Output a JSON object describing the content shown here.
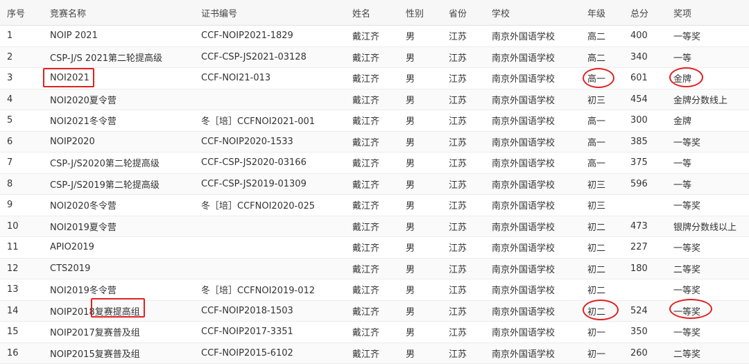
{
  "headers": [
    "序号",
    "竞赛名称",
    "证书编号",
    "姓名",
    "性别",
    "省份",
    "学校",
    "年级",
    "总分",
    "奖项"
  ],
  "rows": [
    [
      "1",
      "NOIP 2021",
      "CCF-NOIP2021-1829",
      "戴江齐",
      "男",
      "江苏",
      "南京外国语学校",
      "高二",
      "400",
      "一等奖"
    ],
    [
      "2",
      "CSP-J/S 2021第二轮提高级",
      "CCF-CSP-JS2021-03128",
      "戴江齐",
      "男",
      "江苏",
      "南京外国语学校",
      "高二",
      "340",
      "一等"
    ],
    [
      "3",
      "NOI2021",
      "CCF-NOI21-013",
      "戴江齐",
      "男",
      "江苏",
      "南京外国语学校",
      "高一",
      "601",
      "金牌"
    ],
    [
      "4",
      "NOI2020夏令营",
      "",
      "戴江齐",
      "男",
      "江苏",
      "南京外国语学校",
      "初三",
      "454",
      "金牌分数线上"
    ],
    [
      "5",
      "NOI2021冬令营",
      "冬［培］CCFNOI2021-001",
      "戴江齐",
      "男",
      "江苏",
      "南京外国语学校",
      "高一",
      "300",
      "金牌"
    ],
    [
      "6",
      "NOIP2020",
      "CCF-NOIP2020-1533",
      "戴江齐",
      "男",
      "江苏",
      "南京外国语学校",
      "高一",
      "385",
      "一等奖"
    ],
    [
      "7",
      "CSP-J/S2020第二轮提高级",
      "CCF-CSP-JS2020-03166",
      "戴江齐",
      "男",
      "江苏",
      "南京外国语学校",
      "高一",
      "375",
      "一等"
    ],
    [
      "8",
      "CSP-J/S2019第二轮提高级",
      "CCF-CSP-JS2019-01309",
      "戴江齐",
      "男",
      "江苏",
      "南京外国语学校",
      "初三",
      "596",
      "一等"
    ],
    [
      "9",
      "NOI2020冬令营",
      "冬［培］CCFNOI2020-025",
      "戴江齐",
      "男",
      "江苏",
      "南京外国语学校",
      "初三",
      "",
      "一等奖"
    ],
    [
      "10",
      "NOI2019夏令营",
      "",
      "戴江齐",
      "男",
      "江苏",
      "南京外国语学校",
      "初二",
      "473",
      "银牌分数线以上"
    ],
    [
      "11",
      "APIO2019",
      "",
      "戴江齐",
      "男",
      "江苏",
      "南京外国语学校",
      "初二",
      "227",
      "一等奖"
    ],
    [
      "12",
      "CTS2019",
      "",
      "戴江齐",
      "男",
      "江苏",
      "南京外国语学校",
      "初二",
      "180",
      "二等奖"
    ],
    [
      "13",
      "NOI2019冬令营",
      "冬［培］CCFNOI2019-012",
      "戴江齐",
      "男",
      "江苏",
      "南京外国语学校",
      "初二",
      "",
      "一等奖"
    ],
    [
      "14",
      "NOIP2018复赛提高组",
      "CCF-NOIP2018-1503",
      "戴江齐",
      "男",
      "江苏",
      "南京外国语学校",
      "初二",
      "524",
      "一等奖"
    ],
    [
      "15",
      "NOIP2017复赛普及组",
      "CCF-NOIP2017-3351",
      "戴江齐",
      "男",
      "江苏",
      "南京外国语学校",
      "初一",
      "350",
      "一等奖"
    ],
    [
      "16",
      "NOIP2015复赛普及组",
      "CCF-NOIP2015-6102",
      "戴江齐",
      "男",
      "江苏",
      "南京外国语学校",
      "初一",
      "260",
      "二等奖"
    ]
  ],
  "annotation_color": "#e02020"
}
